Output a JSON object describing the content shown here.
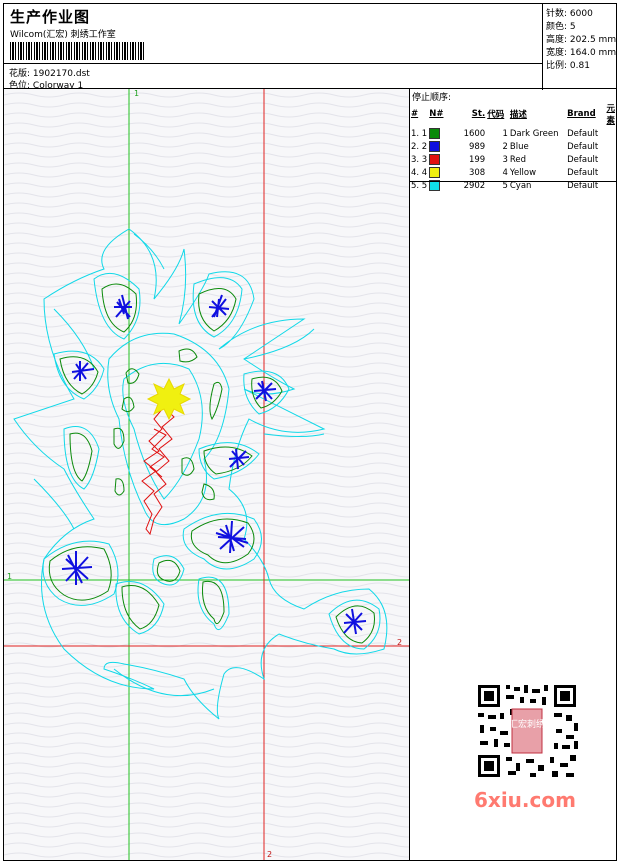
{
  "header": {
    "title": "生产作业图",
    "company": "Wilcom(汇宏) 刺绣工作室",
    "design_label": "花版:",
    "design_value": "1902170.dst",
    "colorway_label": "色位:",
    "colorway_value": "Colorway 1"
  },
  "stats": {
    "stitches_label": "针数:",
    "stitches_value": "6000",
    "colors_label": "颜色:",
    "colors_value": "5",
    "height_label": "高度:",
    "height_value": "202.5 mm",
    "width_label": "宽度:",
    "width_value": "164.0 mm",
    "scale_label": "比例:",
    "scale_value": "0.81"
  },
  "stop_sequence": {
    "title": "停止顺序:",
    "columns": [
      "#",
      "N#",
      "St.",
      "代码",
      "描述",
      "Brand",
      "元素"
    ],
    "rows": [
      {
        "idx": "1. 1",
        "stitches": "1600",
        "code": "1",
        "desc": "Dark Green",
        "brand": "Default",
        "color": "#0a8a0a"
      },
      {
        "idx": "2. 2",
        "stitches": "989",
        "code": "2",
        "desc": "Blue",
        "brand": "Default",
        "color": "#1010e0"
      },
      {
        "idx": "3. 3",
        "stitches": "199",
        "code": "3",
        "desc": "Red",
        "brand": "Default",
        "color": "#e01010"
      },
      {
        "idx": "4. 4",
        "stitches": "308",
        "code": "4",
        "desc": "Yellow",
        "brand": "Default",
        "color": "#f0f010"
      },
      {
        "idx": "5. 5",
        "stitches": "2902",
        "code": "5",
        "desc": "Cyan",
        "brand": "Default",
        "color": "#10e0e8"
      }
    ]
  },
  "guides": {
    "v1_label": "1",
    "h1_label": "1",
    "v2_label": "2",
    "h2_label": "2"
  },
  "watermark": "6xiu.com",
  "seal_text": "汇宏刺绣"
}
